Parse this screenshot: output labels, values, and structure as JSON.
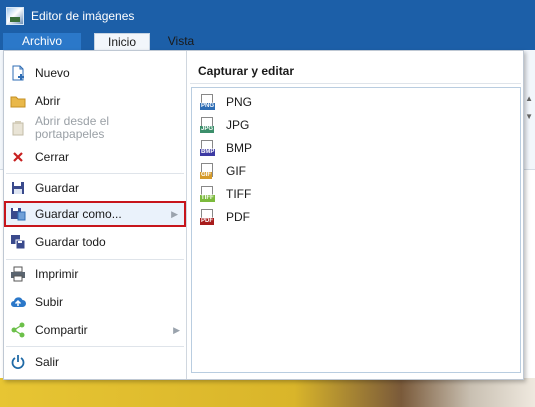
{
  "window": {
    "title": "Editor de imágenes"
  },
  "tabs": {
    "archivo": "Archivo",
    "inicio": "Inicio",
    "vista": "Vista"
  },
  "menu": {
    "items": [
      {
        "label": "Nuevo",
        "icon": "new-file-icon"
      },
      {
        "label": "Abrir",
        "icon": "folder-icon"
      },
      {
        "label": "Abrir desde el portapapeles",
        "icon": "clipboard-icon",
        "disabled": true
      },
      {
        "label": "Cerrar",
        "icon": "close-icon"
      },
      {
        "label": "Guardar",
        "icon": "save-icon"
      },
      {
        "label": "Guardar como...",
        "icon": "save-as-icon",
        "submenu": true,
        "selected": true
      },
      {
        "label": "Guardar todo",
        "icon": "save-all-icon"
      },
      {
        "label": "Imprimir",
        "icon": "printer-icon"
      },
      {
        "label": "Subir",
        "icon": "upload-cloud-icon"
      },
      {
        "label": "Compartir",
        "icon": "share-icon",
        "submenu": true
      },
      {
        "label": "Salir",
        "icon": "power-icon"
      }
    ],
    "submenu_title": "Capturar y editar",
    "formats": [
      {
        "label": "PNG",
        "icon": "png-file-icon",
        "color": "#2f6db4"
      },
      {
        "label": "JPG",
        "icon": "jpg-file-icon",
        "color": "#3c8f6b"
      },
      {
        "label": "BMP",
        "icon": "bmp-file-icon",
        "color": "#3d3aa3"
      },
      {
        "label": "GIF",
        "icon": "gif-file-icon",
        "color": "#d59b2b"
      },
      {
        "label": "TIFF",
        "icon": "tiff-file-icon",
        "color": "#7cba3c"
      },
      {
        "label": "PDF",
        "icon": "pdf-file-icon",
        "color": "#a81c1c"
      }
    ]
  },
  "colors": {
    "titlebar": "#1c5fa8",
    "accent": "#2b78c9",
    "highlight_border": "#c7151b"
  }
}
